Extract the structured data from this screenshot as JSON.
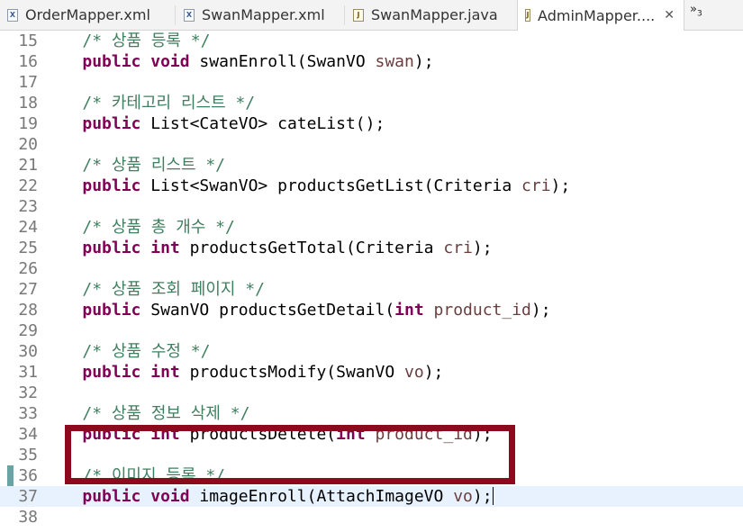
{
  "tabs": [
    {
      "label": "OrderMapper.xml",
      "icon": "xml-file-icon",
      "active": false
    },
    {
      "label": "SwanMapper.xml",
      "icon": "xml-file-icon",
      "active": false
    },
    {
      "label": "SwanMapper.java",
      "icon": "java-file-icon",
      "active": false
    },
    {
      "label": "AdminMapper....",
      "icon": "java-file-icon",
      "active": true
    }
  ],
  "tab_close": "✕",
  "tab_overflow": {
    "symbol": "»",
    "count": "3"
  },
  "editor": {
    "highlight_color": "#8b0a1e",
    "current_line": "37",
    "lines": [
      {
        "num": "15",
        "segments": [
          {
            "t": "    "
          },
          {
            "t": "/* 상품 등록 */",
            "c": "cm"
          }
        ]
      },
      {
        "num": "16",
        "segments": [
          {
            "t": "    "
          },
          {
            "t": "public",
            "c": "kw"
          },
          {
            "t": " "
          },
          {
            "t": "void",
            "c": "kw"
          },
          {
            "t": " swanEnroll(SwanVO "
          },
          {
            "t": "swan",
            "c": "param"
          },
          {
            "t": ");"
          }
        ]
      },
      {
        "num": "17",
        "segments": []
      },
      {
        "num": "18",
        "segments": [
          {
            "t": "    "
          },
          {
            "t": "/* 카테고리 리스트 */",
            "c": "cm"
          }
        ]
      },
      {
        "num": "19",
        "segments": [
          {
            "t": "    "
          },
          {
            "t": "public",
            "c": "kw"
          },
          {
            "t": " List<CateVO> cateList();"
          }
        ]
      },
      {
        "num": "20",
        "segments": []
      },
      {
        "num": "21",
        "segments": [
          {
            "t": "    "
          },
          {
            "t": "/* 상품 리스트 */",
            "c": "cm"
          }
        ]
      },
      {
        "num": "22",
        "segments": [
          {
            "t": "    "
          },
          {
            "t": "public",
            "c": "kw"
          },
          {
            "t": " List<SwanVO> productsGetList(Criteria "
          },
          {
            "t": "cri",
            "c": "param"
          },
          {
            "t": ");"
          }
        ]
      },
      {
        "num": "23",
        "segments": []
      },
      {
        "num": "24",
        "segments": [
          {
            "t": "    "
          },
          {
            "t": "/* 상품 총 개수 */",
            "c": "cm"
          }
        ]
      },
      {
        "num": "25",
        "segments": [
          {
            "t": "    "
          },
          {
            "t": "public",
            "c": "kw"
          },
          {
            "t": " "
          },
          {
            "t": "int",
            "c": "kw"
          },
          {
            "t": " productsGetTotal(Criteria "
          },
          {
            "t": "cri",
            "c": "param"
          },
          {
            "t": ");"
          }
        ]
      },
      {
        "num": "26",
        "segments": []
      },
      {
        "num": "27",
        "segments": [
          {
            "t": "    "
          },
          {
            "t": "/* 상품 조회 페이지 */",
            "c": "cm"
          }
        ]
      },
      {
        "num": "28",
        "segments": [
          {
            "t": "    "
          },
          {
            "t": "public",
            "c": "kw"
          },
          {
            "t": " SwanVO productsGetDetail("
          },
          {
            "t": "int",
            "c": "kw"
          },
          {
            "t": " "
          },
          {
            "t": "product_id",
            "c": "param"
          },
          {
            "t": ");"
          }
        ]
      },
      {
        "num": "29",
        "segments": []
      },
      {
        "num": "30",
        "segments": [
          {
            "t": "    "
          },
          {
            "t": "/* 상품 수정 */",
            "c": "cm"
          }
        ]
      },
      {
        "num": "31",
        "segments": [
          {
            "t": "    "
          },
          {
            "t": "public",
            "c": "kw"
          },
          {
            "t": " "
          },
          {
            "t": "int",
            "c": "kw"
          },
          {
            "t": " productsModify(SwanVO "
          },
          {
            "t": "vo",
            "c": "param"
          },
          {
            "t": ");"
          }
        ]
      },
      {
        "num": "32",
        "segments": []
      },
      {
        "num": "33",
        "segments": [
          {
            "t": "    "
          },
          {
            "t": "/* 상품 정보 삭제 */",
            "c": "cm"
          }
        ]
      },
      {
        "num": "34",
        "segments": [
          {
            "t": "    "
          },
          {
            "t": "public",
            "c": "kw"
          },
          {
            "t": " "
          },
          {
            "t": "int",
            "c": "kw"
          },
          {
            "t": " productsDelete("
          },
          {
            "t": "int",
            "c": "kw"
          },
          {
            "t": " "
          },
          {
            "t": "product_id",
            "c": "param"
          },
          {
            "t": ");"
          }
        ]
      },
      {
        "num": "35",
        "segments": []
      },
      {
        "num": "36",
        "segments": [
          {
            "t": "    "
          },
          {
            "t": "/* 이미지 등록 */",
            "c": "cm"
          }
        ]
      },
      {
        "num": "37",
        "segments": [
          {
            "t": "    "
          },
          {
            "t": "public",
            "c": "kw"
          },
          {
            "t": " "
          },
          {
            "t": "void",
            "c": "kw"
          },
          {
            "t": " imageEnroll(AttachImageVO "
          },
          {
            "t": "vo",
            "c": "param"
          },
          {
            "t": ");"
          }
        ]
      },
      {
        "num": "38",
        "segments": []
      }
    ]
  }
}
